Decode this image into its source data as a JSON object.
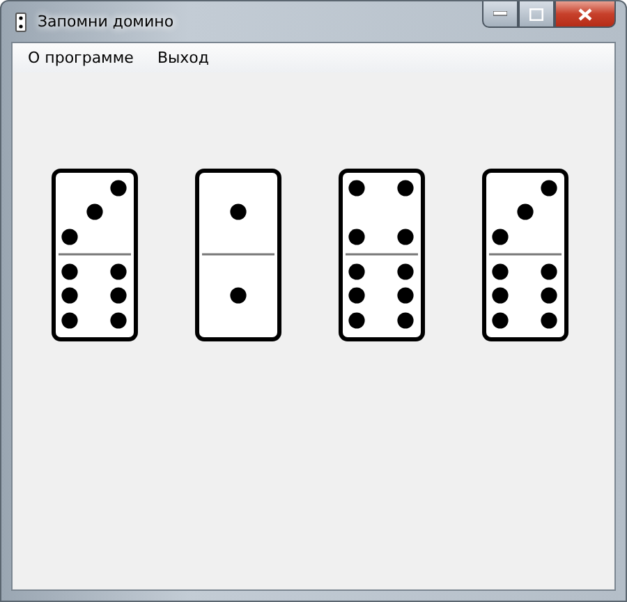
{
  "window": {
    "title": "Запомни домино"
  },
  "menu": [
    {
      "label": "О программе"
    },
    {
      "label": "Выход"
    }
  ],
  "dominoes": [
    {
      "halves": [
        {
          "kind": "three"
        },
        {
          "kind": "six"
        }
      ]
    },
    {
      "halves": [
        {
          "kind": "one"
        },
        {
          "kind": "one"
        }
      ]
    },
    {
      "halves": [
        {
          "kind": "four"
        },
        {
          "kind": "six"
        }
      ]
    },
    {
      "halves": [
        {
          "kind": "three"
        },
        {
          "kind": "six"
        }
      ]
    }
  ]
}
